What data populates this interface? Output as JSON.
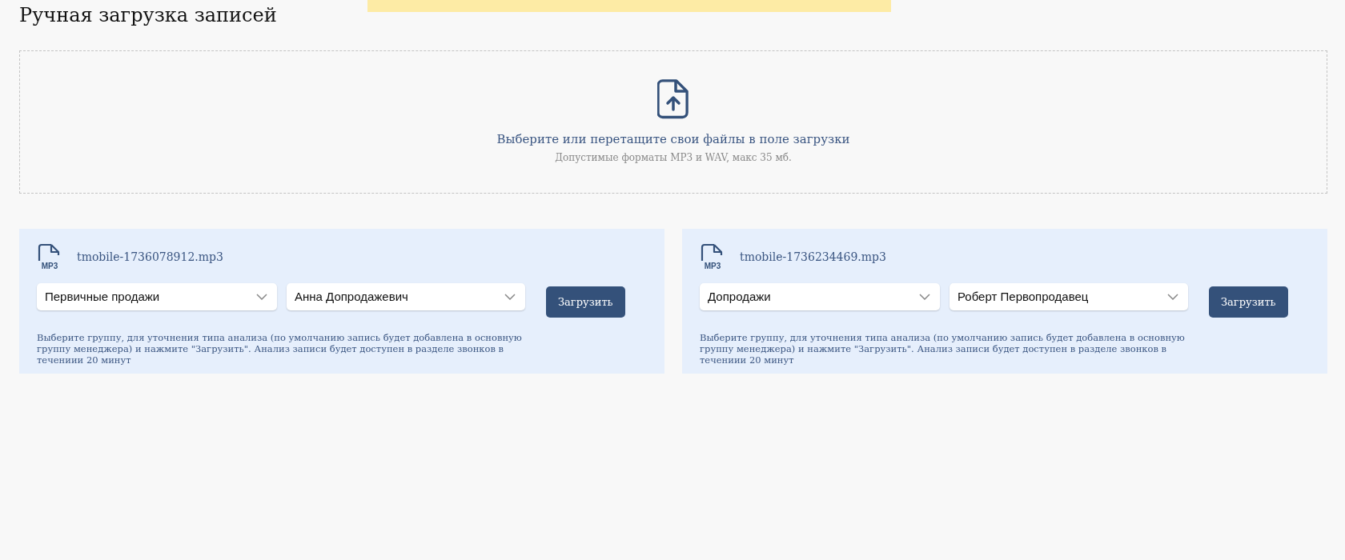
{
  "page": {
    "title": "Ручная загрузка записей"
  },
  "notice_banner": {
    "kind": "banner"
  },
  "dropzone": {
    "prompt": "Выберите или перетащите свои файлы в поле загрузки",
    "hint": "Допустимые форматы MP3 и WAV, макс 35 мб."
  },
  "files": [
    {
      "file_name": "tmobile-1736078912.mp3",
      "icon_label": "MP3",
      "group": "Первичные продажи",
      "manager": "Анна Допродажевич",
      "button": "Загрузить",
      "description": "Выберите группу, для уточнения типа анализа (по умолчанию запись будет добавлена в основную группу менеджера) и нажмите \"Загрузить\". Анализ записи будет доступен в разделе звонков в течениии 20 минут"
    },
    {
      "file_name": "tmobile-1736234469.mp3",
      "icon_label": "MP3",
      "group": "Допродажи",
      "manager": "Роберт Первопродавец",
      "button": "Загрузить",
      "description": "Выберите группу, для уточнения типа анализа (по умолчанию запись будет добавлена в основную группу менеджера) и нажмите \"Загрузить\". Анализ записи будет доступен в разделе звонков в течениии 20 минут"
    }
  ]
}
